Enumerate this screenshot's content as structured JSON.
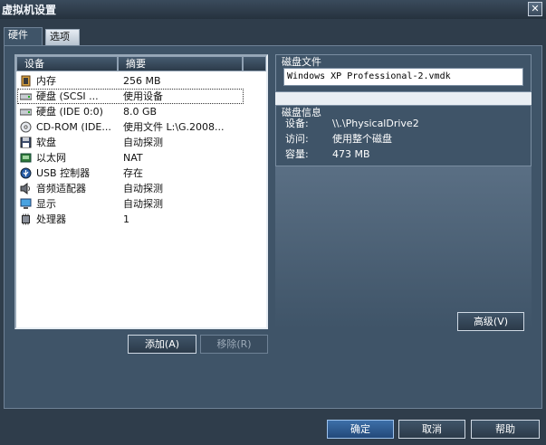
{
  "window": {
    "title": "虚拟机设置",
    "close_glyph": "✕"
  },
  "tabs": [
    {
      "label": "硬件"
    },
    {
      "label": "选项"
    }
  ],
  "device_list": {
    "headers": {
      "device": "设备",
      "summary": "摘要"
    },
    "rows": [
      {
        "device": "内存",
        "summary": "256 MB",
        "icon": "memory-icon"
      },
      {
        "device": "硬盘 (SCSI ...",
        "summary": "使用设备",
        "icon": "hard-disk-icon",
        "selected": true
      },
      {
        "device": "硬盘 (IDE 0:0)",
        "summary": "8.0 GB",
        "icon": "hard-disk-icon"
      },
      {
        "device": "CD-ROM (IDE...",
        "summary": "使用文件 L:\\G.2008...",
        "icon": "cdrom-icon"
      },
      {
        "device": "软盘",
        "summary": "自动探测",
        "icon": "floppy-icon"
      },
      {
        "device": "以太网",
        "summary": "NAT",
        "icon": "ethernet-icon"
      },
      {
        "device": "USB 控制器",
        "summary": "存在",
        "icon": "usb-icon"
      },
      {
        "device": "音频适配器",
        "summary": "自动探测",
        "icon": "audio-icon"
      },
      {
        "device": "显示",
        "summary": "自动探测",
        "icon": "display-icon"
      },
      {
        "device": "处理器",
        "summary": "1",
        "icon": "processor-icon"
      }
    ]
  },
  "list_buttons": {
    "add": "添加(A)",
    "remove": "移除(R)"
  },
  "disk_file": {
    "title": "磁盘文件",
    "value": "Windows XP Professional-2.vmdk"
  },
  "disk_info": {
    "title": "磁盘信息",
    "rows": [
      {
        "key": "设备:",
        "value": "\\\\.\\PhysicalDrive2"
      },
      {
        "key": "访问:",
        "value": "使用整个磁盘"
      },
      {
        "key": "容量:",
        "value": "473 MB"
      }
    ]
  },
  "advanced_button": "高级(V)",
  "footer": {
    "ok": "确定",
    "cancel": "取消",
    "help": "帮助"
  },
  "colors": {
    "window_bg": "#2f3d4b",
    "panel": "#3f5468",
    "accent_button": "#3d6fa8"
  }
}
